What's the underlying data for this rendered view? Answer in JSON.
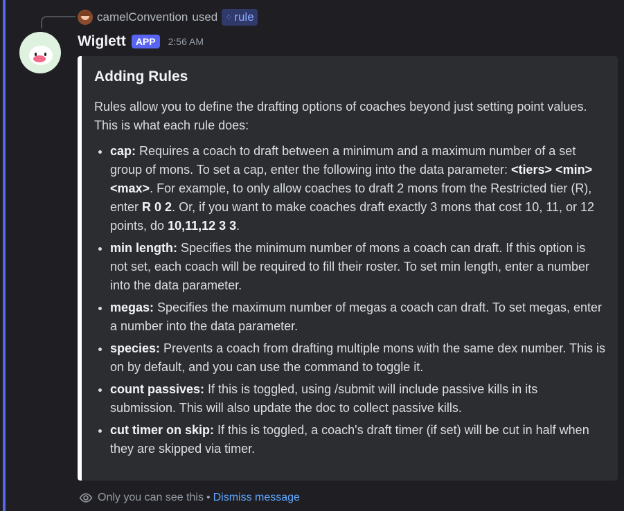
{
  "reply": {
    "username": "camelConvention",
    "used_text": "used",
    "command": "rule",
    "command_icon": "slash-command-icon"
  },
  "message": {
    "username": "Wiglett",
    "badge": "APP",
    "timestamp": "2:56 AM"
  },
  "embed": {
    "title": "Adding Rules",
    "description": "Rules allow you to define the drafting options of coaches beyond just setting point values. This is what each rule does:",
    "rules": [
      {
        "name": "cap:",
        "text1": " Requires a coach to draft between a minimum and a maximum number of a set group of mons. To set a cap, enter the following into the data parameter: ",
        "bold1": "<tiers> <min> <max>",
        "text2": ". For example, to only allow coaches to draft 2 mons from the Restricted tier (R), enter ",
        "bold2": "R 0 2",
        "text3": ". Or, if you want to make coaches draft exactly 3 mons that cost 10, 11, or 12 points, do ",
        "bold3": "10,11,12 3 3",
        "text4": "."
      },
      {
        "name": "min length:",
        "text": " Specifies the minimum number of mons a coach can draft. If this option is not set, each coach will be required to fill their roster. To set min length, enter a number into the data parameter."
      },
      {
        "name": "megas:",
        "text": " Specifies the maximum number of megas a coach can draft. To set megas, enter a number into the data parameter."
      },
      {
        "name": "species:",
        "text": " Prevents a coach from drafting multiple mons with the same dex number. This is on by default, and you can use the command to toggle it."
      },
      {
        "name": "count passives:",
        "text": " If this is toggled, using /submit will include passive kills in its submission. This will also update the doc to collect passive kills."
      },
      {
        "name": "cut timer on skip:",
        "text": " If this is toggled, a coach's draft timer (if set) will be cut in half when they are skipped via timer."
      }
    ]
  },
  "footer": {
    "visibility_text": "Only you can see this",
    "separator": "•",
    "dismiss": "Dismiss message"
  },
  "colors": {
    "accent": "#5865f2",
    "link": "#5ea6ff",
    "background": "#1f1f23",
    "embed_bg": "#2b2d31"
  }
}
